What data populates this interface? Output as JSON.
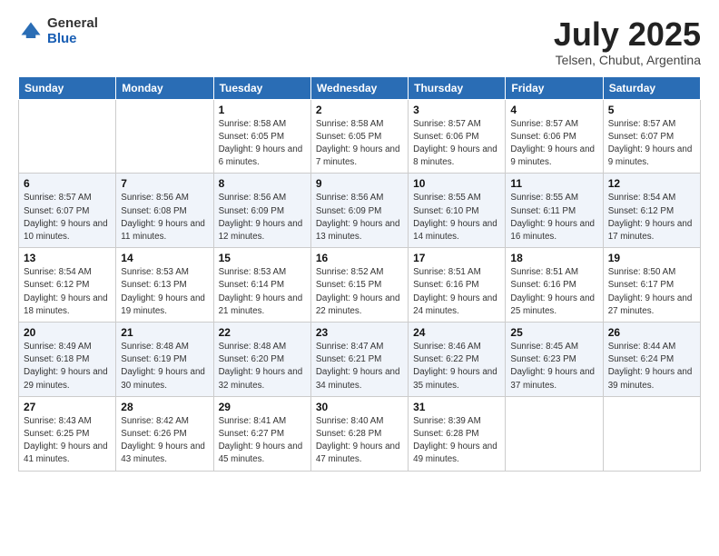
{
  "header": {
    "logo_line1": "General",
    "logo_line2": "Blue",
    "title": "July 2025",
    "location": "Telsen, Chubut, Argentina"
  },
  "weekdays": [
    "Sunday",
    "Monday",
    "Tuesday",
    "Wednesday",
    "Thursday",
    "Friday",
    "Saturday"
  ],
  "weeks": [
    [
      {
        "day": "",
        "detail": ""
      },
      {
        "day": "",
        "detail": ""
      },
      {
        "day": "1",
        "detail": "Sunrise: 8:58 AM\nSunset: 6:05 PM\nDaylight: 9 hours and 6 minutes."
      },
      {
        "day": "2",
        "detail": "Sunrise: 8:58 AM\nSunset: 6:05 PM\nDaylight: 9 hours and 7 minutes."
      },
      {
        "day": "3",
        "detail": "Sunrise: 8:57 AM\nSunset: 6:06 PM\nDaylight: 9 hours and 8 minutes."
      },
      {
        "day": "4",
        "detail": "Sunrise: 8:57 AM\nSunset: 6:06 PM\nDaylight: 9 hours and 9 minutes."
      },
      {
        "day": "5",
        "detail": "Sunrise: 8:57 AM\nSunset: 6:07 PM\nDaylight: 9 hours and 9 minutes."
      }
    ],
    [
      {
        "day": "6",
        "detail": "Sunrise: 8:57 AM\nSunset: 6:07 PM\nDaylight: 9 hours and 10 minutes."
      },
      {
        "day": "7",
        "detail": "Sunrise: 8:56 AM\nSunset: 6:08 PM\nDaylight: 9 hours and 11 minutes."
      },
      {
        "day": "8",
        "detail": "Sunrise: 8:56 AM\nSunset: 6:09 PM\nDaylight: 9 hours and 12 minutes."
      },
      {
        "day": "9",
        "detail": "Sunrise: 8:56 AM\nSunset: 6:09 PM\nDaylight: 9 hours and 13 minutes."
      },
      {
        "day": "10",
        "detail": "Sunrise: 8:55 AM\nSunset: 6:10 PM\nDaylight: 9 hours and 14 minutes."
      },
      {
        "day": "11",
        "detail": "Sunrise: 8:55 AM\nSunset: 6:11 PM\nDaylight: 9 hours and 16 minutes."
      },
      {
        "day": "12",
        "detail": "Sunrise: 8:54 AM\nSunset: 6:12 PM\nDaylight: 9 hours and 17 minutes."
      }
    ],
    [
      {
        "day": "13",
        "detail": "Sunrise: 8:54 AM\nSunset: 6:12 PM\nDaylight: 9 hours and 18 minutes."
      },
      {
        "day": "14",
        "detail": "Sunrise: 8:53 AM\nSunset: 6:13 PM\nDaylight: 9 hours and 19 minutes."
      },
      {
        "day": "15",
        "detail": "Sunrise: 8:53 AM\nSunset: 6:14 PM\nDaylight: 9 hours and 21 minutes."
      },
      {
        "day": "16",
        "detail": "Sunrise: 8:52 AM\nSunset: 6:15 PM\nDaylight: 9 hours and 22 minutes."
      },
      {
        "day": "17",
        "detail": "Sunrise: 8:51 AM\nSunset: 6:16 PM\nDaylight: 9 hours and 24 minutes."
      },
      {
        "day": "18",
        "detail": "Sunrise: 8:51 AM\nSunset: 6:16 PM\nDaylight: 9 hours and 25 minutes."
      },
      {
        "day": "19",
        "detail": "Sunrise: 8:50 AM\nSunset: 6:17 PM\nDaylight: 9 hours and 27 minutes."
      }
    ],
    [
      {
        "day": "20",
        "detail": "Sunrise: 8:49 AM\nSunset: 6:18 PM\nDaylight: 9 hours and 29 minutes."
      },
      {
        "day": "21",
        "detail": "Sunrise: 8:48 AM\nSunset: 6:19 PM\nDaylight: 9 hours and 30 minutes."
      },
      {
        "day": "22",
        "detail": "Sunrise: 8:48 AM\nSunset: 6:20 PM\nDaylight: 9 hours and 32 minutes."
      },
      {
        "day": "23",
        "detail": "Sunrise: 8:47 AM\nSunset: 6:21 PM\nDaylight: 9 hours and 34 minutes."
      },
      {
        "day": "24",
        "detail": "Sunrise: 8:46 AM\nSunset: 6:22 PM\nDaylight: 9 hours and 35 minutes."
      },
      {
        "day": "25",
        "detail": "Sunrise: 8:45 AM\nSunset: 6:23 PM\nDaylight: 9 hours and 37 minutes."
      },
      {
        "day": "26",
        "detail": "Sunrise: 8:44 AM\nSunset: 6:24 PM\nDaylight: 9 hours and 39 minutes."
      }
    ],
    [
      {
        "day": "27",
        "detail": "Sunrise: 8:43 AM\nSunset: 6:25 PM\nDaylight: 9 hours and 41 minutes."
      },
      {
        "day": "28",
        "detail": "Sunrise: 8:42 AM\nSunset: 6:26 PM\nDaylight: 9 hours and 43 minutes."
      },
      {
        "day": "29",
        "detail": "Sunrise: 8:41 AM\nSunset: 6:27 PM\nDaylight: 9 hours and 45 minutes."
      },
      {
        "day": "30",
        "detail": "Sunrise: 8:40 AM\nSunset: 6:28 PM\nDaylight: 9 hours and 47 minutes."
      },
      {
        "day": "31",
        "detail": "Sunrise: 8:39 AM\nSunset: 6:28 PM\nDaylight: 9 hours and 49 minutes."
      },
      {
        "day": "",
        "detail": ""
      },
      {
        "day": "",
        "detail": ""
      }
    ]
  ]
}
